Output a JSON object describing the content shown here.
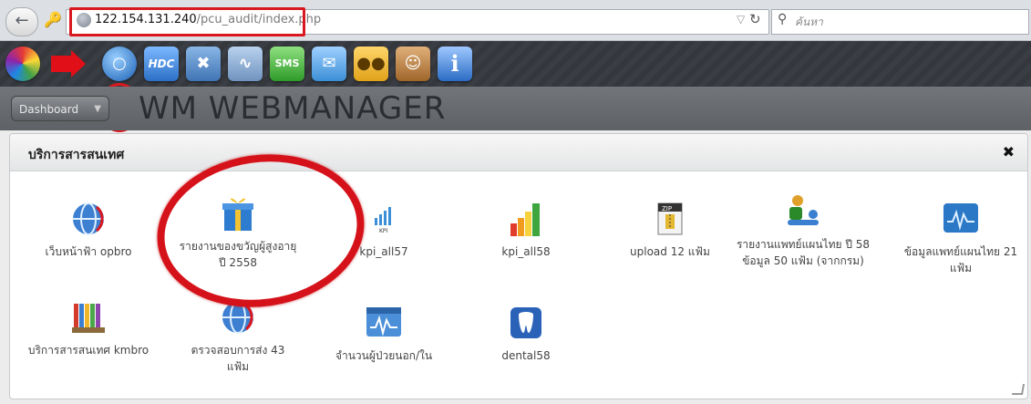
{
  "browser": {
    "url_host": "122.154.131.240",
    "url_path": "/pcu_audit/index.php",
    "search_placeholder": "ค้นหา"
  },
  "toolbar": {
    "icons": [
      "color-wheel-icon",
      "red-arrow-icon",
      "globe-app-icon",
      "hdc-icon",
      "tools-icon",
      "pulse-icon",
      "sms-icon",
      "mail-icon",
      "users-icon",
      "user-profile-icon",
      "info-icon"
    ]
  },
  "header": {
    "dashboard_label": "Dashboard",
    "app_title": "WM WEBMANAGER"
  },
  "panel": {
    "title": "บริการสารสนเทศ",
    "items": [
      {
        "label": "เว็บหน้าฟ้า opbro",
        "icon": "globe-icon"
      },
      {
        "label": "รายงานของขวัญผู้สูงอายุ ปี 2558",
        "icon": "gift-icon"
      },
      {
        "label": "kpi_all57",
        "icon": "kpi-chart-icon"
      },
      {
        "label": "kpi_all58",
        "icon": "bar-chart-icon"
      },
      {
        "label": "upload 12 แฟ้ม",
        "icon": "zip-icon"
      },
      {
        "label": "รายงานแพทย์แผนไทย ปี 58 ข้อมูล 50 แฟ้ม (จากกรม)",
        "icon": "massage-icon"
      },
      {
        "label": "ข้อมูลแพทย์แผนไทย 21 แฟ้ม",
        "icon": "monitor-wave-icon"
      },
      {
        "label": "บริการสารสนเทศ kmbro",
        "icon": "books-icon"
      },
      {
        "label": "ตรวจสอบการส่ง 43 แฟ้ม",
        "icon": "globe-icon"
      },
      {
        "label": "จำนวนผู้ป่วยนอก/ใน",
        "icon": "calendar-wave-icon"
      },
      {
        "label": "dental58",
        "icon": "tooth-icon"
      }
    ]
  },
  "colors": {
    "annotation_red": "#d9181f"
  }
}
